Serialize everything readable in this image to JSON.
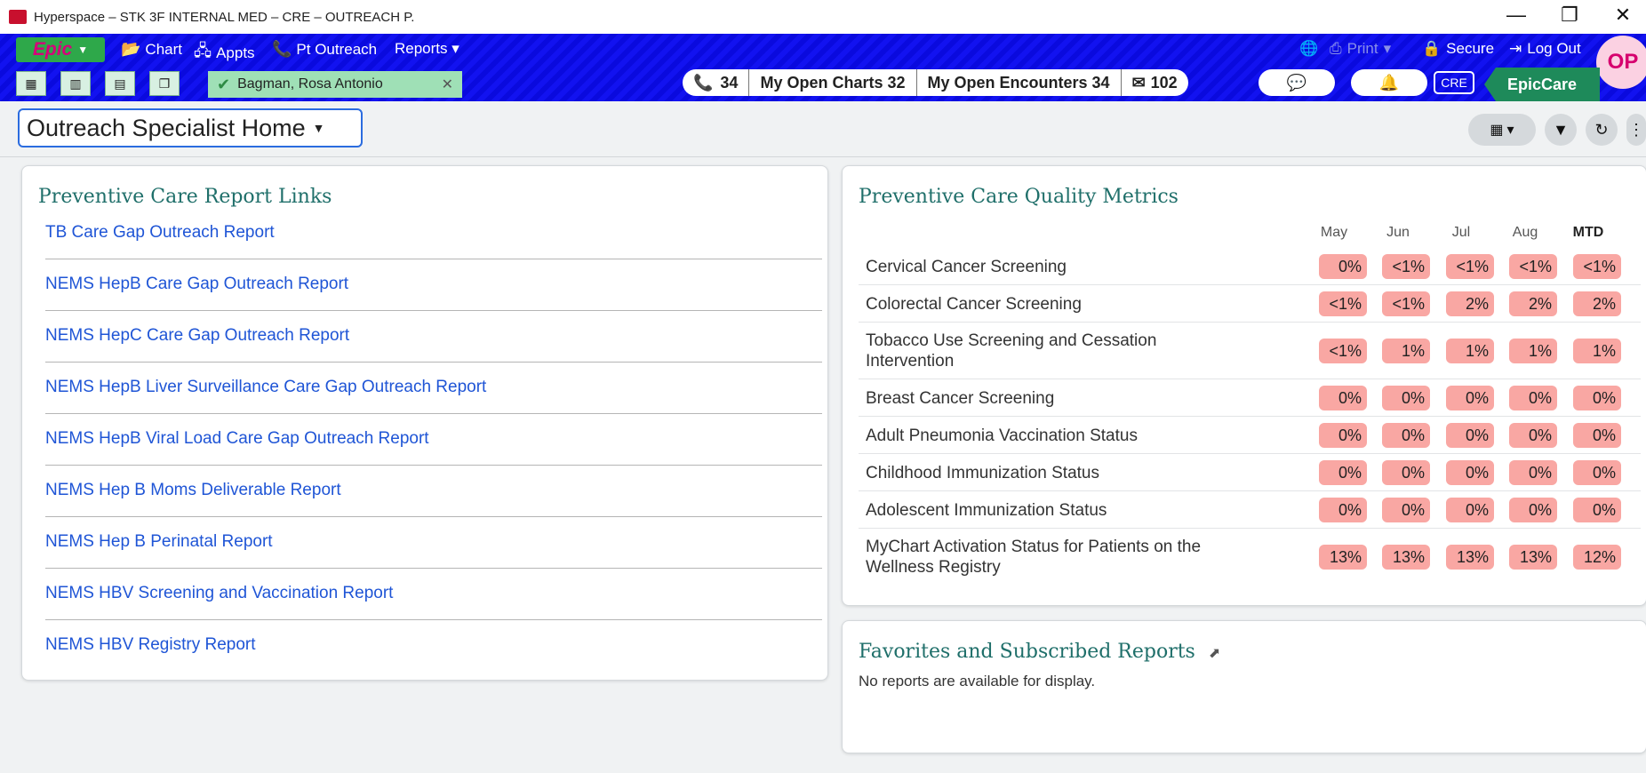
{
  "window": {
    "title": "Hyperspace – STK 3F INTERNAL MED – CRE – OUTREACH P.",
    "minimize": "—",
    "maximize": "❐",
    "close": "✕"
  },
  "toolbar": {
    "epic_label": "Epic",
    "menu": [
      {
        "label": "Chart",
        "icon": "folder-icon",
        "glyph": "📂"
      },
      {
        "label": "Appts",
        "icon": "org-chart-icon",
        "glyph": "🖧"
      },
      {
        "label": "Pt Outreach",
        "icon": "phone-icon",
        "glyph": "📞"
      },
      {
        "label": "Reports ▾",
        "icon": "",
        "glyph": ""
      }
    ],
    "globe_glyph": "🌐",
    "print_label": "Print",
    "secure_label": "Secure",
    "logout_label": "Log Out",
    "avatar_initials": "OP"
  },
  "activity_bar": {
    "patient_name": "Bagman, Rosa Antonio",
    "calls": "34",
    "open_charts": "My Open Charts 32",
    "open_encounters": "My Open Encounters 34",
    "inbox": "102",
    "cre_badge": "CRE",
    "epiccare": "EpicCare"
  },
  "page": {
    "title": "Outreach Specialist Home"
  },
  "report_links": {
    "title": "Preventive Care Report Links",
    "items": [
      "TB Care Gap Outreach Report",
      "NEMS HepB Care Gap Outreach Report",
      "NEMS HepC Care Gap Outreach Report",
      "NEMS HepB Liver Surveillance Care Gap Outreach Report",
      "NEMS HepB Viral Load Care Gap Outreach Report",
      "NEMS Hep B Moms Deliverable Report",
      "NEMS Hep B Perinatal Report",
      "NEMS HBV Screening and Vaccination Report",
      "NEMS HBV Registry Report"
    ]
  },
  "metrics": {
    "title": "Preventive Care Quality Metrics",
    "columns": [
      "May",
      "Jun",
      "Jul",
      "Aug",
      "MTD"
    ],
    "rows": [
      {
        "name": "Cervical Cancer Screening",
        "values": [
          "0%",
          "<1%",
          "<1%",
          "<1%",
          "<1%"
        ]
      },
      {
        "name": "Colorectal Cancer Screening",
        "values": [
          "<1%",
          "<1%",
          "2%",
          "2%",
          "2%"
        ]
      },
      {
        "name": "Tobacco Use Screening and Cessation Intervention",
        "values": [
          "<1%",
          "1%",
          "1%",
          "1%",
          "1%"
        ]
      },
      {
        "name": "Breast Cancer Screening",
        "values": [
          "0%",
          "0%",
          "0%",
          "0%",
          "0%"
        ]
      },
      {
        "name": "Adult Pneumonia Vaccination Status",
        "values": [
          "0%",
          "0%",
          "0%",
          "0%",
          "0%"
        ]
      },
      {
        "name": "Childhood Immunization Status",
        "values": [
          "0%",
          "0%",
          "0%",
          "0%",
          "0%"
        ]
      },
      {
        "name": "Adolescent Immunization Status",
        "values": [
          "0%",
          "0%",
          "0%",
          "0%",
          "0%"
        ]
      },
      {
        "name": "MyChart Activation Status for Patients on the Wellness Registry",
        "values": [
          "13%",
          "13%",
          "13%",
          "13%",
          "12%"
        ]
      }
    ]
  },
  "favorites": {
    "title": "Favorites and Subscribed Reports",
    "empty_message": "No reports are available for display."
  },
  "colors": {
    "toolbar_blue": "#1212f0",
    "epic_green": "#2ea84a",
    "epiccare_green": "#1e8a5a",
    "link_blue": "#1f55d6",
    "title_teal": "#1f6f6a",
    "metric_badge": "#f9a7a3"
  }
}
